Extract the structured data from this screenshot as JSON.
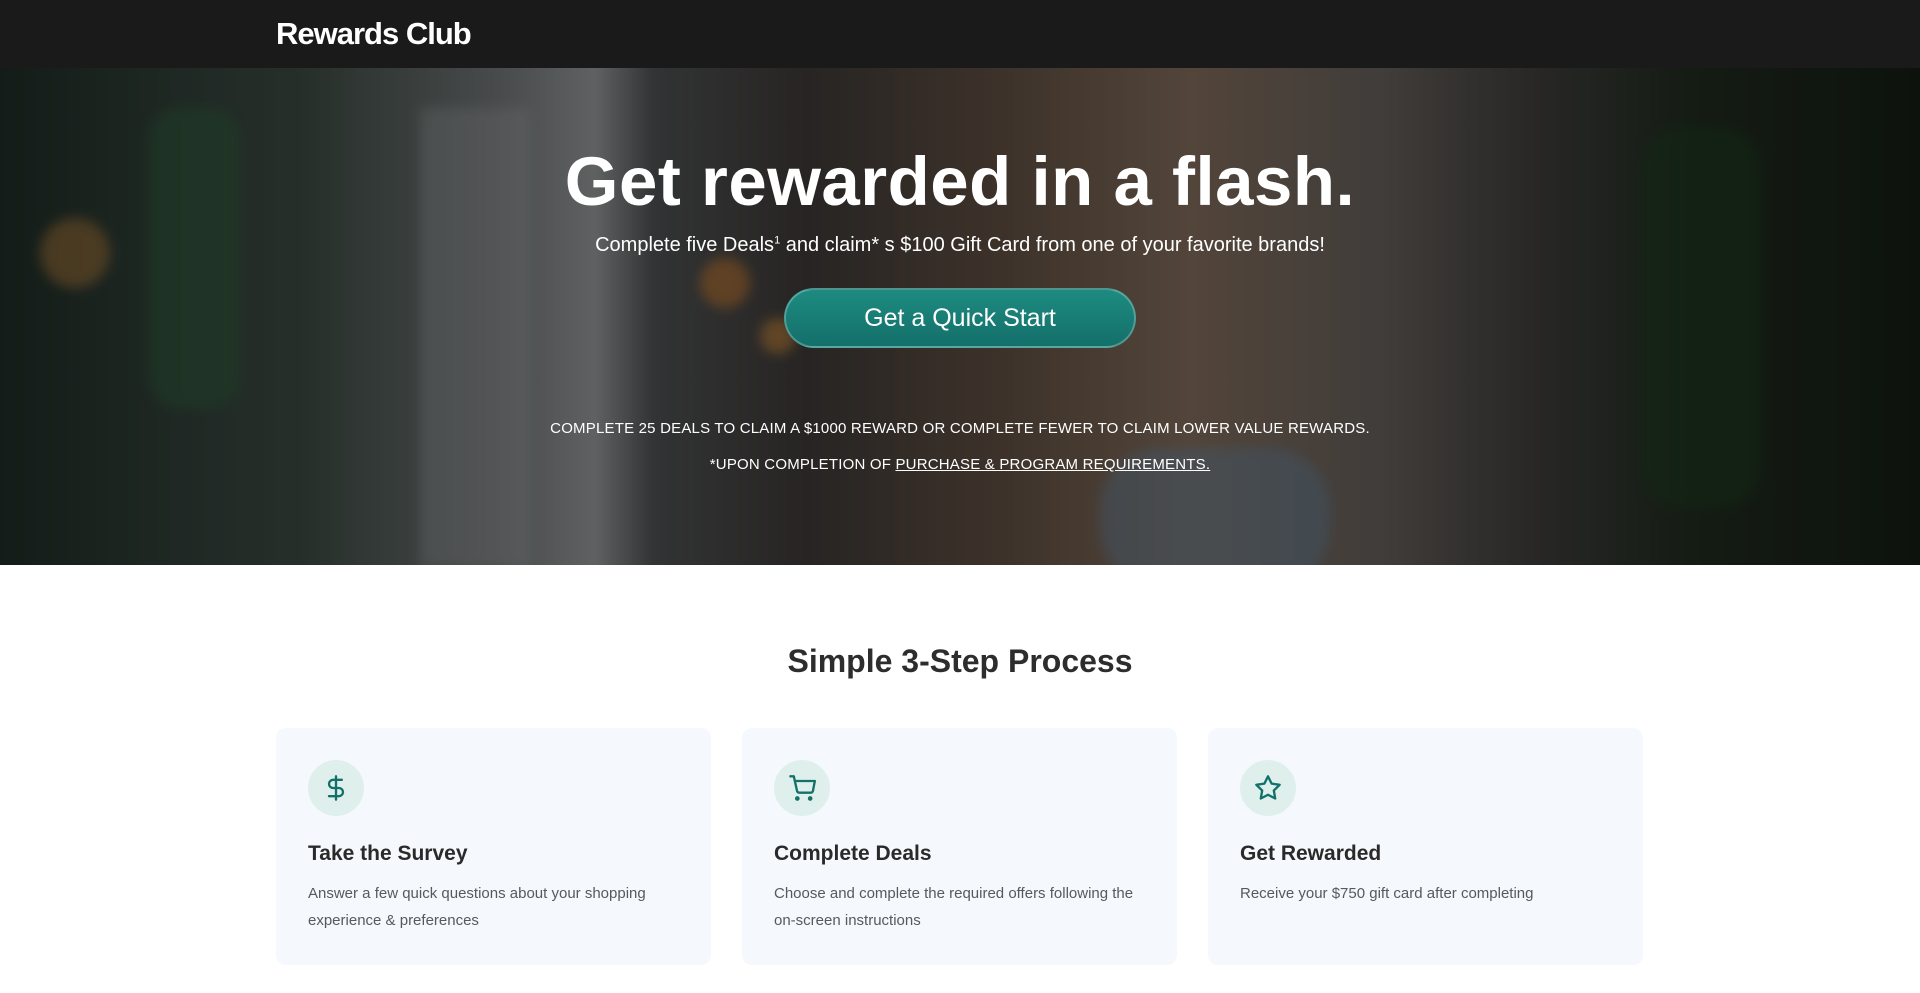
{
  "header": {
    "brand": "Rewards Club"
  },
  "hero": {
    "title": "Get rewarded in a flash.",
    "subtitle_pre": "Complete five Deals",
    "subtitle_sup": "1",
    "subtitle_post": " and claim* s $100 Gift Card from one of your favorite brands!",
    "cta_label": "Get a Quick Start",
    "note": "COMPLETE 25 DEALS TO CLAIM A $1000 REWARD OR COMPLETE FEWER TO CLAIM LOWER VALUE REWARDS.",
    "note2_pre": "*UPON COMPLETION OF ",
    "note2_link": "PURCHASE & PROGRAM REQUIREMENTS."
  },
  "process": {
    "title": "Simple 3-Step Process",
    "steps": [
      {
        "icon": "dollar-icon",
        "title": "Take the Survey",
        "text": "Answer a few quick questions about your shopping experience & preferences"
      },
      {
        "icon": "cart-icon",
        "title": "Complete Deals",
        "text": "Choose and complete the required offers following the on-screen instructions"
      },
      {
        "icon": "star-icon",
        "title": "Get Rewarded",
        "text": "Receive your $750 gift card after completing"
      }
    ]
  },
  "colors": {
    "accent": "#13706a",
    "icon_bg": "#dff0ec",
    "topbar": "#1a1a1a",
    "card_bg": "#f5f8fc"
  }
}
